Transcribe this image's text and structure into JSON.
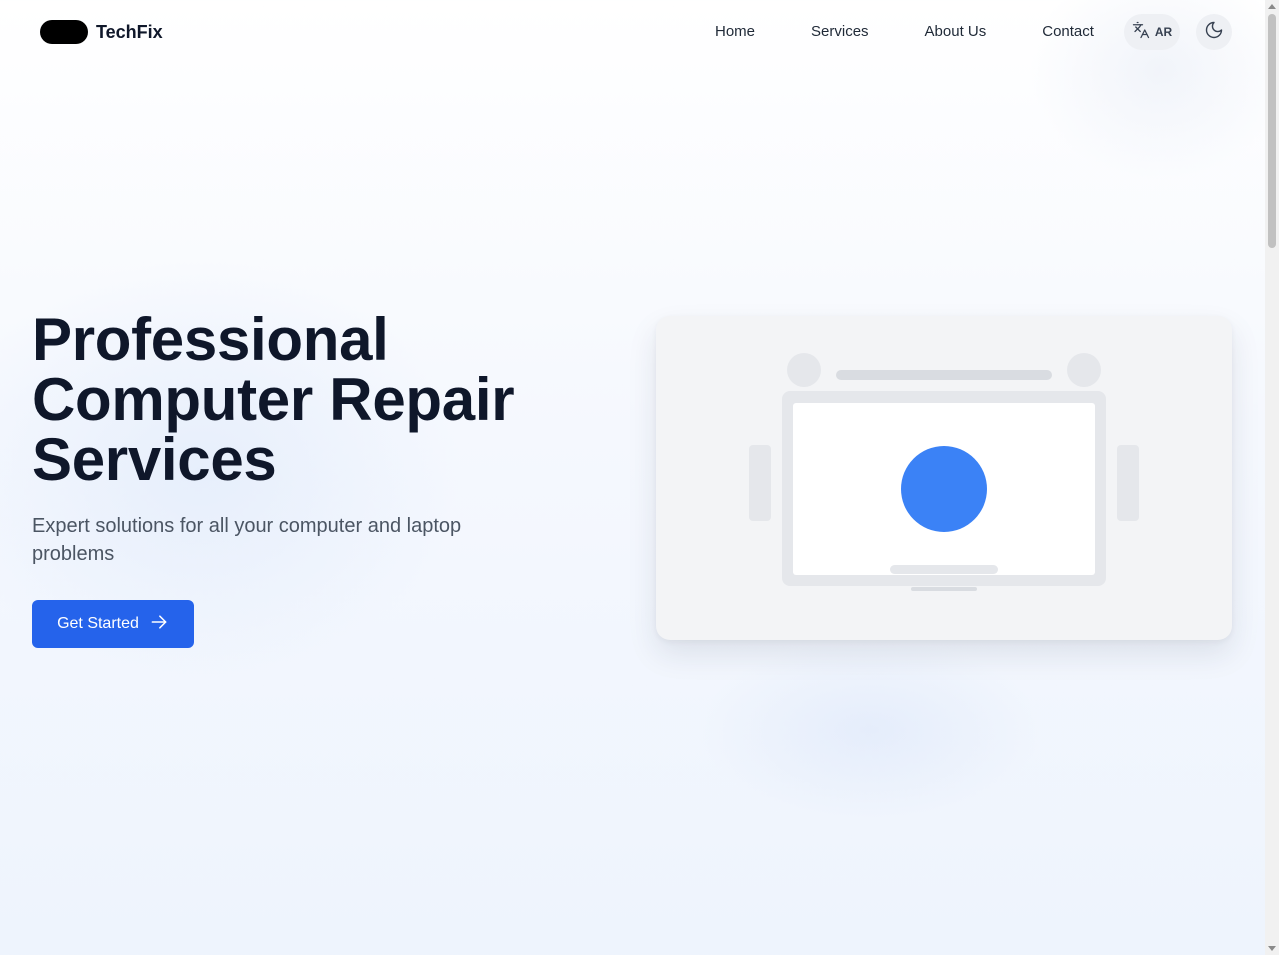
{
  "brand": {
    "name": "TechFix",
    "logo_color": "#000000"
  },
  "nav": {
    "items": [
      {
        "label": "Home"
      },
      {
        "label": "Services"
      },
      {
        "label": "About Us"
      },
      {
        "label": "Contact"
      }
    ],
    "language_button": {
      "label": "AR",
      "icon": "translate-icon"
    },
    "theme_button": {
      "icon": "moon-icon"
    }
  },
  "hero": {
    "title": "Professional Computer Repair Services",
    "subtitle": "Expert solutions for all your computer and laptop problems",
    "cta": {
      "label": "Get Started",
      "icon": "arrow-right-icon"
    }
  },
  "illustration": {
    "icon": "laptop-illustration",
    "accent_color": "#3b82f6"
  },
  "colors": {
    "primary": "#2563eb",
    "heading": "#0f172a",
    "body_text": "#4b5563"
  }
}
